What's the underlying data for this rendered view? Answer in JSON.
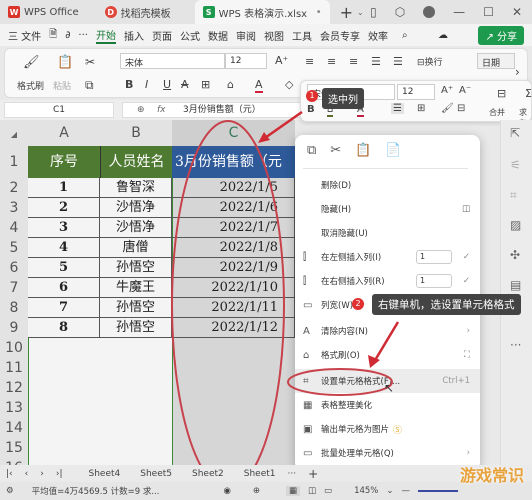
{
  "titlebar": {
    "tabs": [
      {
        "label": "WPS Office",
        "logo": "W"
      },
      {
        "label": "找稻壳模板",
        "logo": "D"
      },
      {
        "label": "WPS  表格演示.xlsx",
        "logo": "S"
      }
    ],
    "new_tab": "+"
  },
  "menubar": {
    "file": "三 文件",
    "items": [
      "开始",
      "插入",
      "页面",
      "公式",
      "数据",
      "审阅",
      "视图",
      "工具",
      "会员专享",
      "效率"
    ],
    "share": "分享"
  },
  "ribbon": {
    "format_painter": "格式刷",
    "paste": "粘贴",
    "font_name": "宋体",
    "font_size": "12",
    "wrap": "换行",
    "number_format": "日期"
  },
  "mini_toolbar": {
    "font_name": "宋体",
    "font_size": "12",
    "merge": "合并",
    "sum": "求和"
  },
  "formula_bar": {
    "cell_ref": "C1",
    "formula": "3月份销售额（元）"
  },
  "sheet": {
    "columns": [
      "A",
      "B",
      "C"
    ],
    "headers": [
      "序号",
      "人员姓名",
      "3月份销售额（元"
    ],
    "rows": [
      {
        "num": "1",
        "name": "鲁智深",
        "date": "2022/1/5"
      },
      {
        "num": "2",
        "name": "沙悟净",
        "date": "2022/1/6"
      },
      {
        "num": "3",
        "name": "沙悟净",
        "date": "2022/1/7"
      },
      {
        "num": "4",
        "name": "唐僧",
        "date": "2022/1/8"
      },
      {
        "num": "5",
        "name": "孙悟空",
        "date": "2022/1/9"
      },
      {
        "num": "6",
        "name": "牛魔王",
        "date": "2022/1/10"
      },
      {
        "num": "7",
        "name": "孙悟空",
        "date": "2022/1/11"
      },
      {
        "num": "8",
        "name": "孙悟空",
        "date": "2022/1/12"
      }
    ],
    "row_numbers": [
      "1",
      "2",
      "3",
      "4",
      "5",
      "6",
      "7",
      "8",
      "9",
      "10",
      "11",
      "12",
      "13",
      "14",
      "15",
      "16"
    ]
  },
  "context_menu": {
    "items": [
      {
        "label": "删除(D)"
      },
      {
        "label": "隐藏(H)"
      },
      {
        "label": "取消隐藏(U)"
      },
      {
        "label": "在左侧插入列(I)",
        "spin": "1"
      },
      {
        "label": "在右侧插入列(R)",
        "spin": "1"
      },
      {
        "label": "列宽(W)..."
      },
      {
        "label": "清除内容(N)"
      },
      {
        "label": "格式刷(O)"
      },
      {
        "label": "设置单元格格式(F)...",
        "shortcut": "Ctrl+1"
      },
      {
        "label": "表格整理美化"
      },
      {
        "label": "输出单元格为图片"
      },
      {
        "label": "批量处理单元格(Q)"
      }
    ]
  },
  "annotations": {
    "step1_badge": "1",
    "step1_text": "选中列",
    "step2_badge": "2",
    "step2_text": "右键单机，选设置单元格格式"
  },
  "sheet_tabs": [
    "Sheet4",
    "Sheet5",
    "Sheet2",
    "Sheet1"
  ],
  "statusbar": {
    "summary": "平均值=4万4569.5  计数=9  求...",
    "zoom": "145%"
  },
  "watermark": "游戏常识"
}
